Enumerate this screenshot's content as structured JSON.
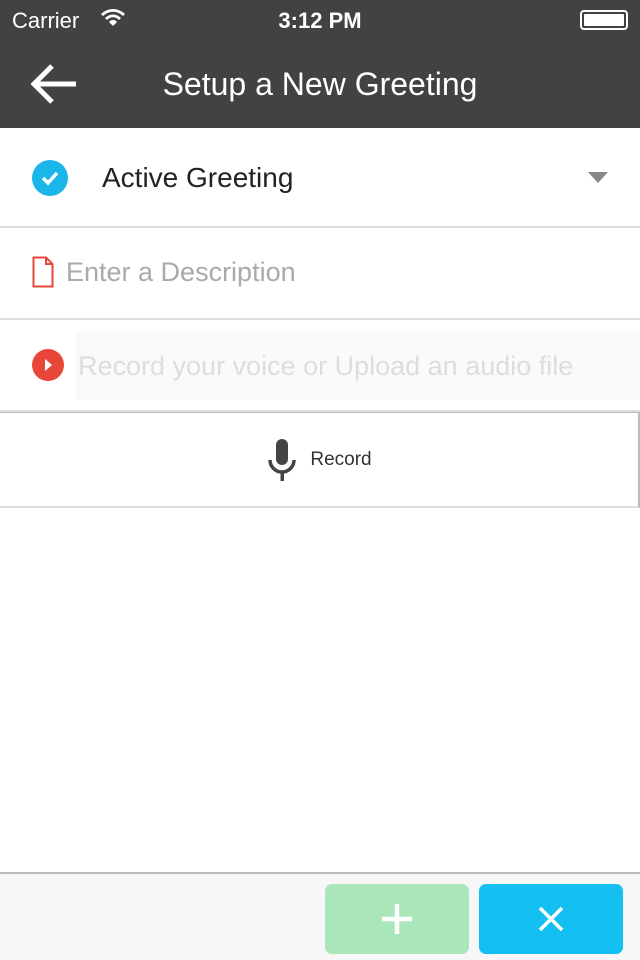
{
  "status_bar": {
    "carrier": "Carrier",
    "time": "3:12 PM",
    "battery_level": 1.0
  },
  "header": {
    "title": "Setup a New Greeting",
    "back_icon": "arrow-left-icon"
  },
  "form": {
    "greeting_type": {
      "value": "Active Greeting",
      "checked": true,
      "accent": "#1ab6ea"
    },
    "description": {
      "value": "",
      "placeholder": "Enter a Description",
      "icon_color": "#e9463a"
    },
    "audio": {
      "value": "",
      "placeholder": "Record your voice or Upload an audio file",
      "icon_color": "#e9463a"
    },
    "record_label": "Record"
  },
  "footer": {
    "add_icon": "plus-icon",
    "add_color": "#abe6bb",
    "cancel_icon": "close-icon",
    "cancel_color": "#14c0f1"
  }
}
